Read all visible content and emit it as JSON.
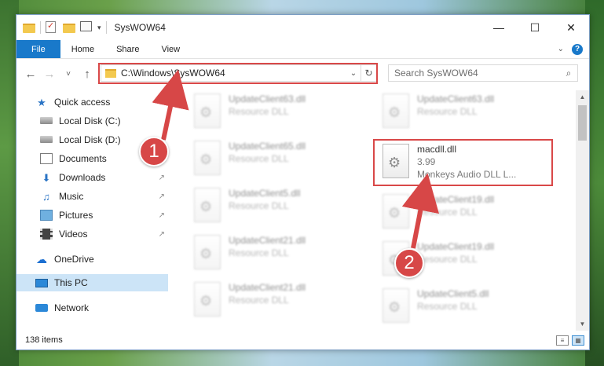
{
  "window": {
    "title": "SysWOW64",
    "controls": {
      "minimize": "—",
      "maximize": "☐",
      "close": "✕"
    }
  },
  "ribbon": {
    "tabs": [
      "File",
      "Home",
      "Share",
      "View"
    ],
    "expand_icon": "chevron-down-icon",
    "help_label": "?"
  },
  "nav": {
    "back": "←",
    "forward": "→",
    "recent": "˅",
    "up": "↑",
    "address": "C:\\Windows\\SysWOW64",
    "search_placeholder": "Search SysWOW64",
    "refresh": "↻",
    "search_icon": "⌕"
  },
  "sidebar": {
    "items": [
      {
        "label": "Quick access",
        "icon": "star-icon",
        "pinned": false
      },
      {
        "label": "Local Disk (C:)",
        "icon": "disk-icon",
        "pinned": false
      },
      {
        "label": "Local Disk (D:)",
        "icon": "disk-icon",
        "pinned": false
      },
      {
        "label": "Documents",
        "icon": "documents-icon",
        "pinned": false
      },
      {
        "label": "Downloads",
        "icon": "downloads-icon",
        "pinned": true
      },
      {
        "label": "Music",
        "icon": "music-icon",
        "pinned": true
      },
      {
        "label": "Pictures",
        "icon": "pictures-icon",
        "pinned": true
      },
      {
        "label": "Videos",
        "icon": "videos-icon",
        "pinned": true
      },
      {
        "label": "OneDrive",
        "icon": "onedrive-icon",
        "pinned": false
      },
      {
        "label": "This PC",
        "icon": "this-pc-icon",
        "pinned": false,
        "selected": true
      },
      {
        "label": "Network",
        "icon": "network-icon",
        "pinned": false
      }
    ],
    "pin_glyph": "↗"
  },
  "files": {
    "left_column": [
      {
        "name": "UpdateClient63.dll",
        "type": "Resource DLL"
      },
      {
        "name": "UpdateClient65.dll",
        "type": "Resource DLL"
      },
      {
        "name": "UpdateClient5.dll",
        "type": "Resource DLL"
      },
      {
        "name": "UpdateClient21.dll",
        "type": "Resource DLL"
      },
      {
        "name": "UpdateClient21.dll",
        "type": "Resource DLL"
      }
    ],
    "right_column": [
      {
        "name": "UpdateClient63.dll",
        "type": "Resource DLL"
      },
      {
        "name": "macdll.dll",
        "version": "3.99",
        "description": "Monkeys Audio DLL L...",
        "highlighted": true
      },
      {
        "name": "UpdateClient19.dll",
        "type": "Resource DLL"
      },
      {
        "name": "UpdateClient19.dll",
        "type": "Resource DLL"
      },
      {
        "name": "UpdateClient5.dll",
        "type": "Resource DLL"
      }
    ]
  },
  "status": {
    "item_count": "138 items",
    "view_details": "≡",
    "view_tiles": "▦"
  },
  "annotations": {
    "callout_1": "1",
    "callout_2": "2",
    "color": "#d74747"
  }
}
